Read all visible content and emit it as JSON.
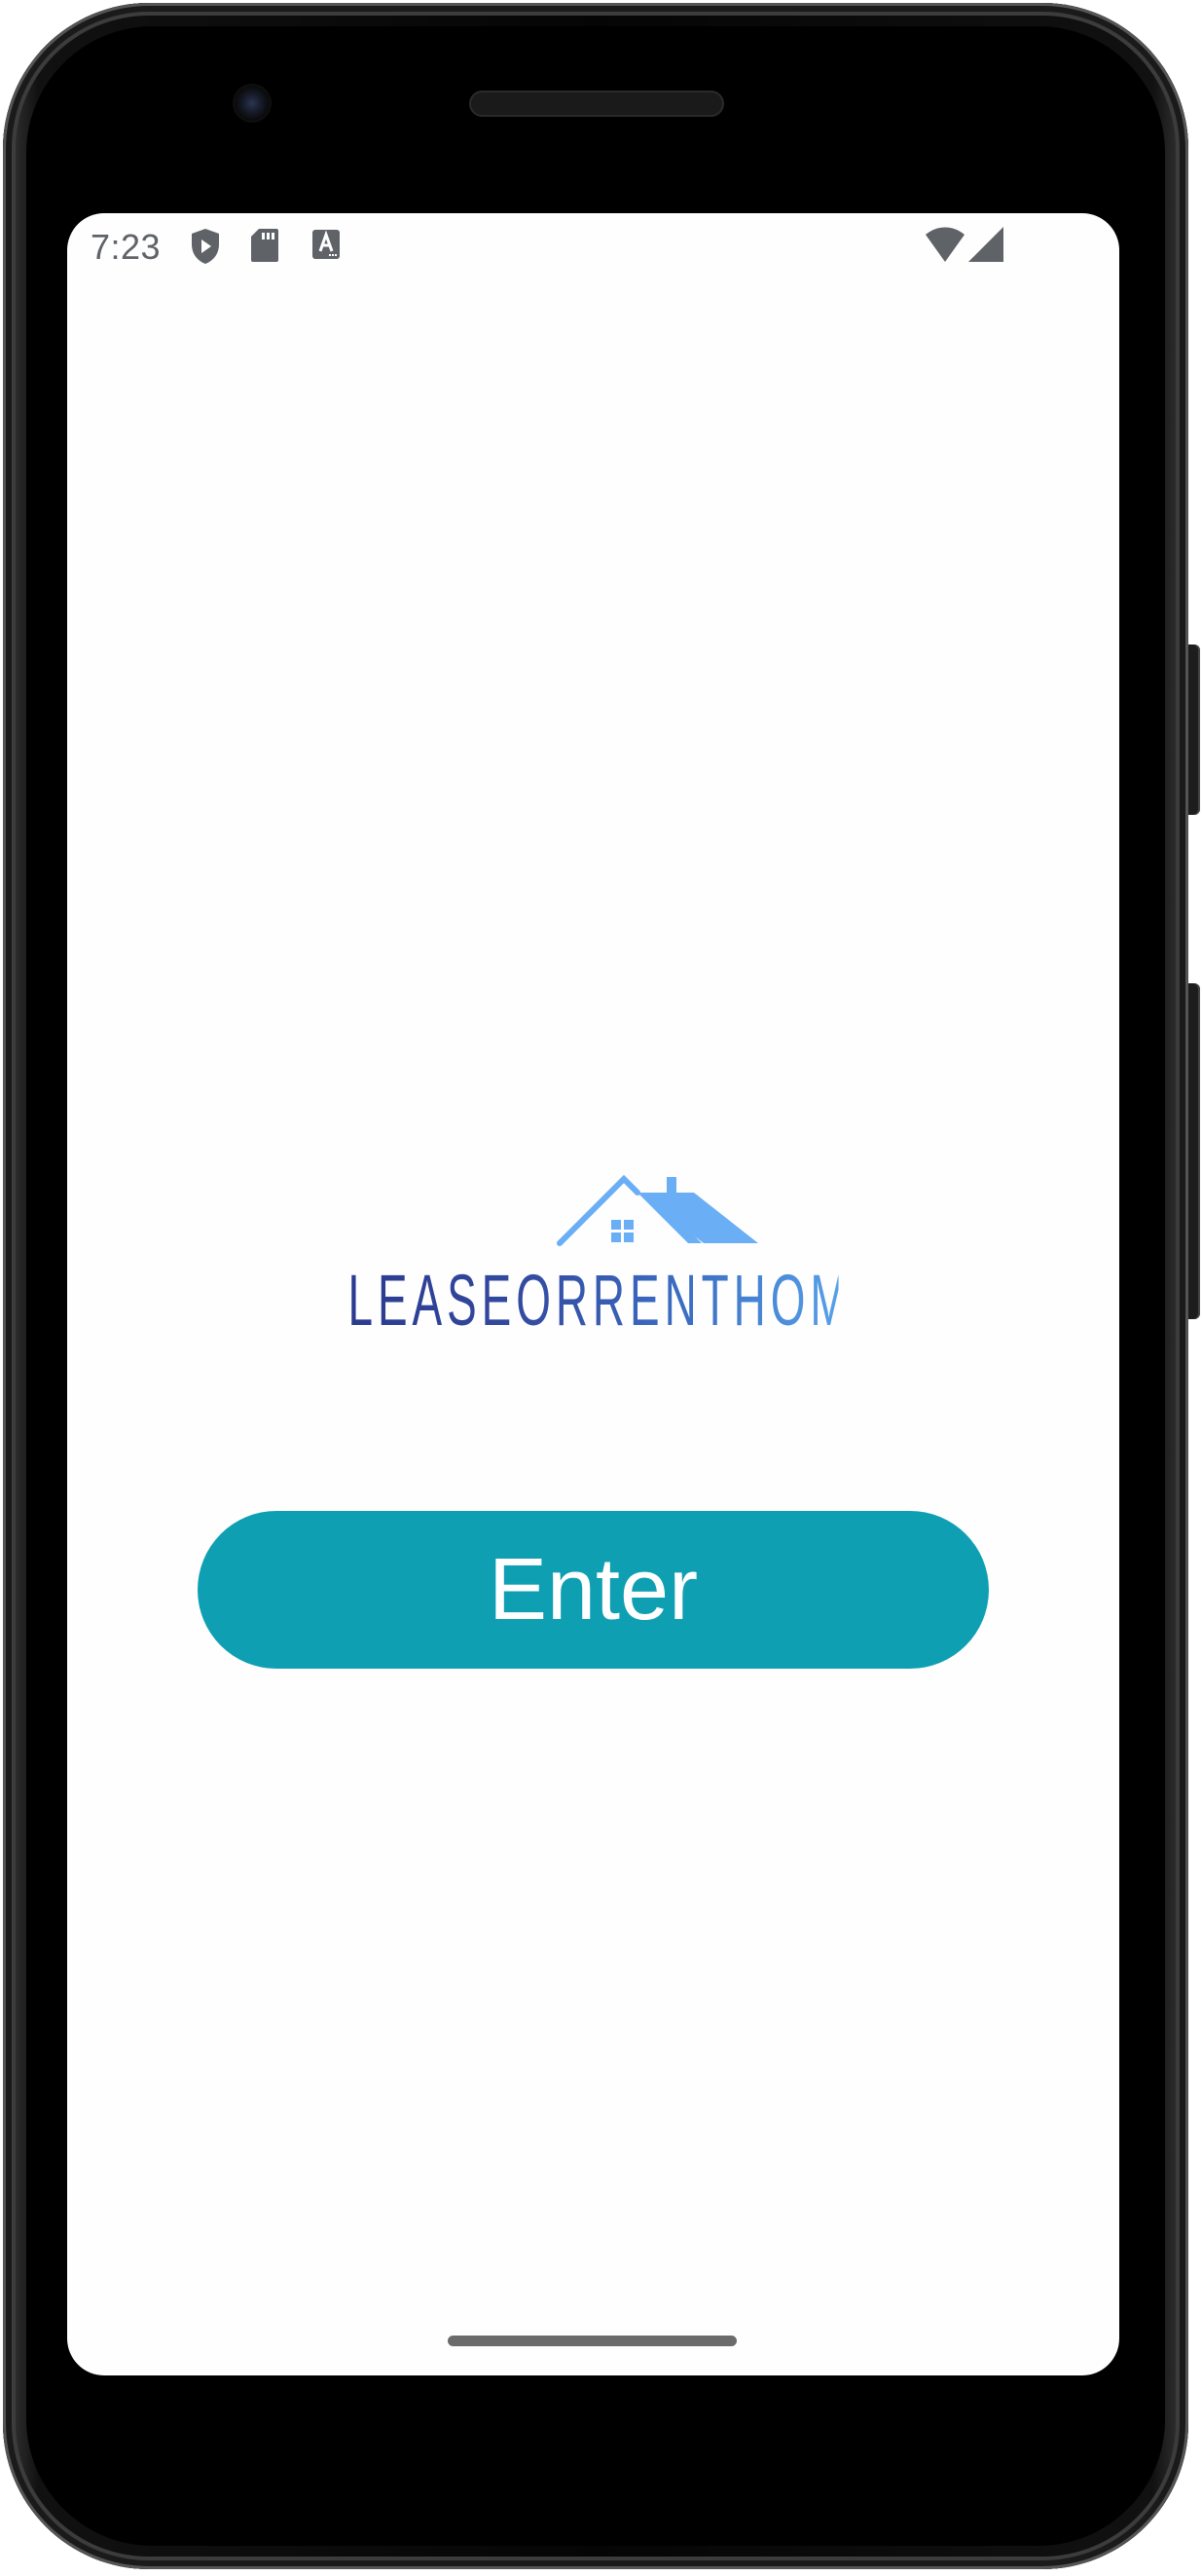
{
  "status_bar": {
    "time": "7:23",
    "icons": [
      "play-protect-icon",
      "sd-card-icon",
      "text-accessibility-icon",
      "wifi-icon",
      "cell-signal-icon"
    ]
  },
  "logo": {
    "wordmark": "LEASEORRENTHOME INC",
    "icon": "house-roof-icon",
    "colors": {
      "dark": "#2b3a8f",
      "light": "#56a0e8",
      "roof": "#6aaef5"
    }
  },
  "main": {
    "enter_label": "Enter",
    "button_color": "#0f9fb3"
  }
}
